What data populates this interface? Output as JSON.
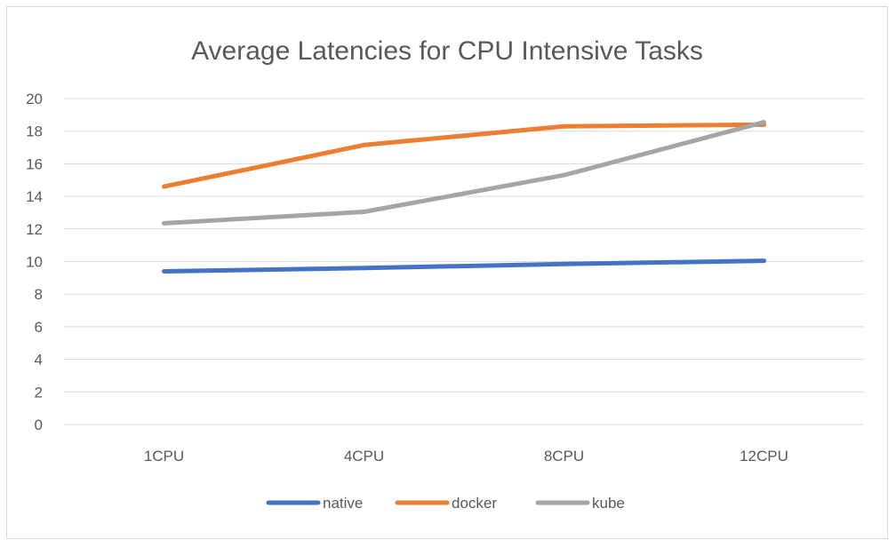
{
  "chart_data": {
    "type": "line",
    "title": "Average Latencies for CPU Intensive Tasks",
    "xlabel": "",
    "ylabel": "",
    "categories": [
      "1CPU",
      "4CPU",
      "8CPU",
      "12CPU"
    ],
    "ylim": [
      0,
      20
    ],
    "yticks": [
      0,
      2,
      4,
      6,
      8,
      10,
      12,
      14,
      16,
      18,
      20
    ],
    "grid": true,
    "legend_position": "bottom",
    "series": [
      {
        "name": "native",
        "color": "#4472c4",
        "values": [
          9.4,
          9.6,
          9.85,
          10.05
        ]
      },
      {
        "name": "docker",
        "color": "#ed7d31",
        "values": [
          14.6,
          17.15,
          18.3,
          18.4
        ]
      },
      {
        "name": "kube",
        "color": "#a5a5a5",
        "values": [
          12.35,
          13.05,
          15.3,
          18.55
        ]
      }
    ]
  }
}
